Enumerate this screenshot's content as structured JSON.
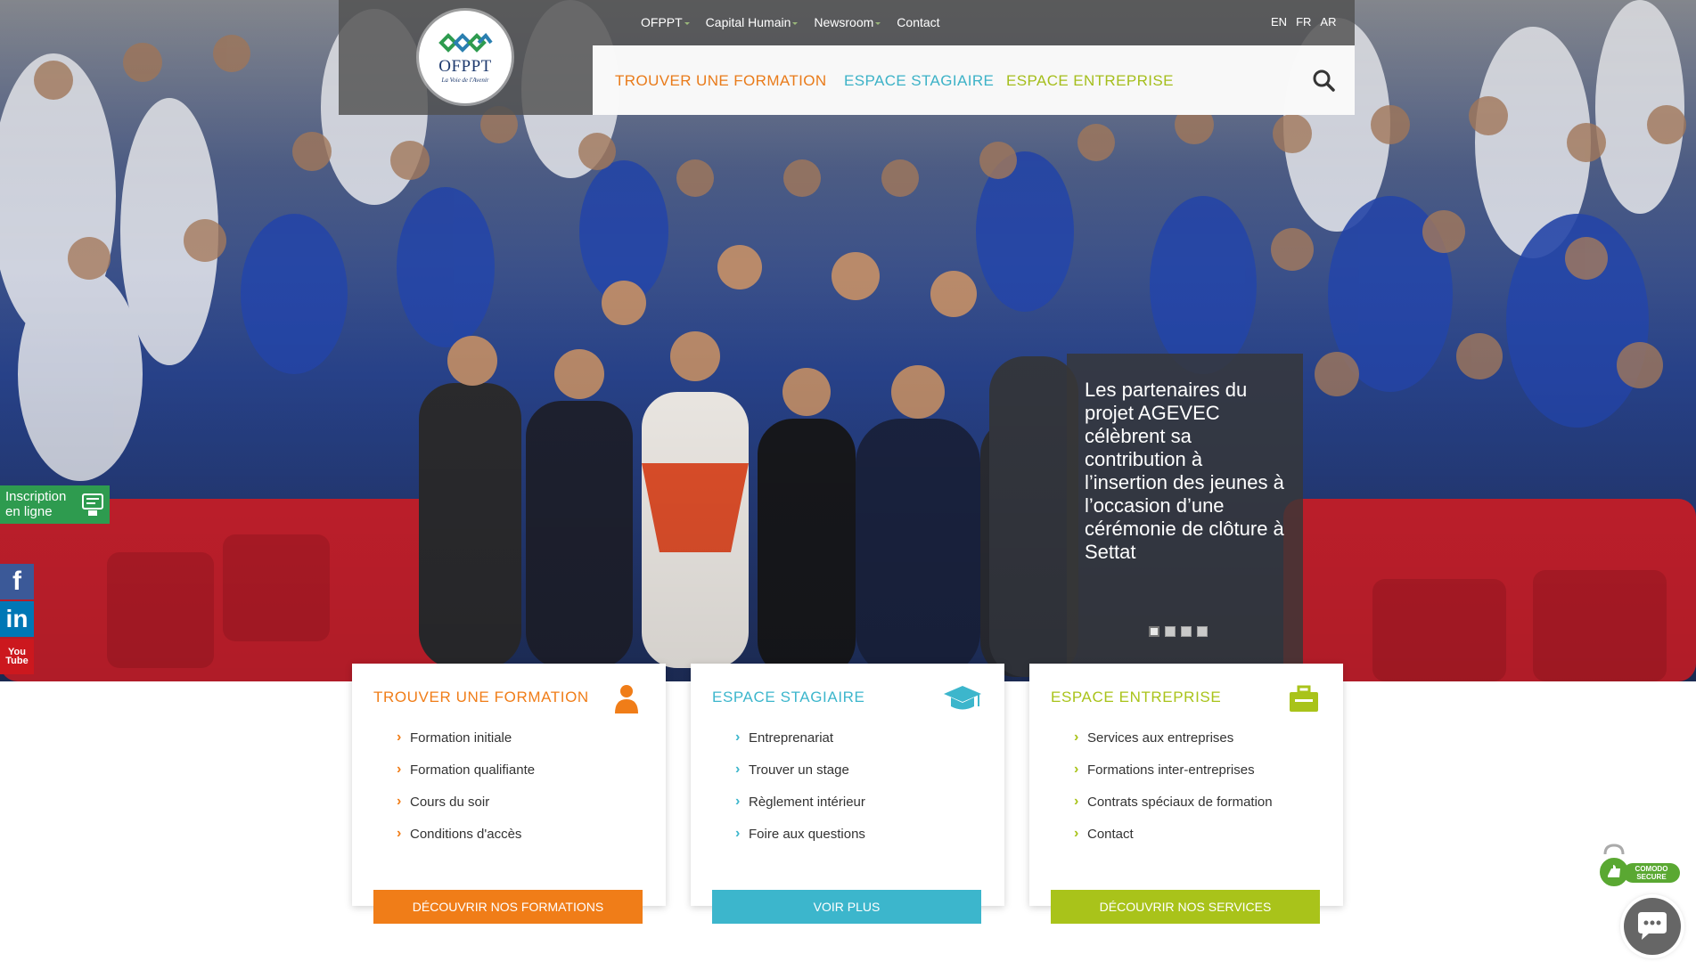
{
  "header": {
    "logo_text": "OFPPT",
    "logo_tagline": "La Voie de l'Avenir",
    "top_links": [
      "OFPPT",
      "Capital Humain",
      "Newsroom",
      "Contact"
    ],
    "languages": [
      "EN",
      "FR",
      "AR"
    ],
    "main_nav": [
      {
        "label": "Trouver une formation",
        "color": "#f07d18"
      },
      {
        "label": "Espace stagiaire",
        "color": "#3cb6cc"
      },
      {
        "label": "Espace entreprise",
        "color": "#a9c31a"
      }
    ]
  },
  "side": {
    "inscription_line1": "Inscription",
    "inscription_line2": "en ligne",
    "facebook": "f",
    "linkedin": "in",
    "youtube_top": "You",
    "youtube_bottom": "Tube"
  },
  "slider": {
    "caption": "Les partenaires du projet AGEVEC célèbrent sa contribution à l’insertion des jeunes à l’occasion d’une cérémonie de clôture à Settat",
    "dot_count": 4,
    "active_index": 0
  },
  "cards": [
    {
      "title": "Trouver une formation",
      "color": "#f07d18",
      "icon": "person-icon",
      "items": [
        "Formation initiale",
        "Formation qualifiante",
        "Cours du soir",
        "Conditions d'accès"
      ],
      "button": "Découvrir nos formations"
    },
    {
      "title": "Espace stagiaire",
      "color": "#3cb6cc",
      "icon": "graduation-cap-icon",
      "items": [
        "Entreprenariat",
        "Trouver un stage",
        "Règlement intérieur",
        "Foire aux questions"
      ],
      "button": "Voir plus"
    },
    {
      "title": "Espace entreprise",
      "color": "#a9c31a",
      "icon": "briefcase-icon",
      "items": [
        "Services aux entreprises",
        "Formations inter-entreprises",
        "Contrats spéciaux de formation",
        "Contact"
      ],
      "button": "Découvrir nos services"
    }
  ],
  "badges": {
    "comodo_line1": "COMODO",
    "comodo_line2": "SECURE"
  }
}
